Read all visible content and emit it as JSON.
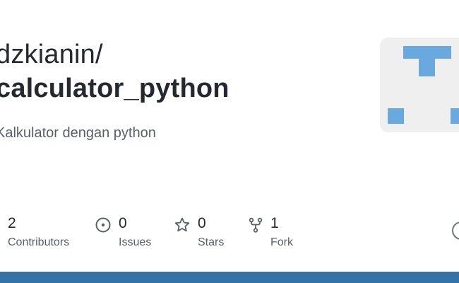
{
  "repo": {
    "owner": "dzkianin/",
    "name": "calculator_python",
    "description": "Kalkulator dengan python"
  },
  "stats": {
    "contributors": {
      "value": "2",
      "label": "Contributors"
    },
    "issues": {
      "value": "0",
      "label": "Issues"
    },
    "stars": {
      "value": "0",
      "label": "Stars"
    },
    "forks": {
      "value": "1",
      "label": "Fork"
    }
  },
  "icons": {
    "issues": "issue-opened-icon",
    "stars": "star-icon",
    "forks": "repo-forked-icon"
  },
  "colors": {
    "language_bar": "#3572a5",
    "avatar_pattern": "#6aa8e0",
    "avatar_bg": "#efefef"
  }
}
